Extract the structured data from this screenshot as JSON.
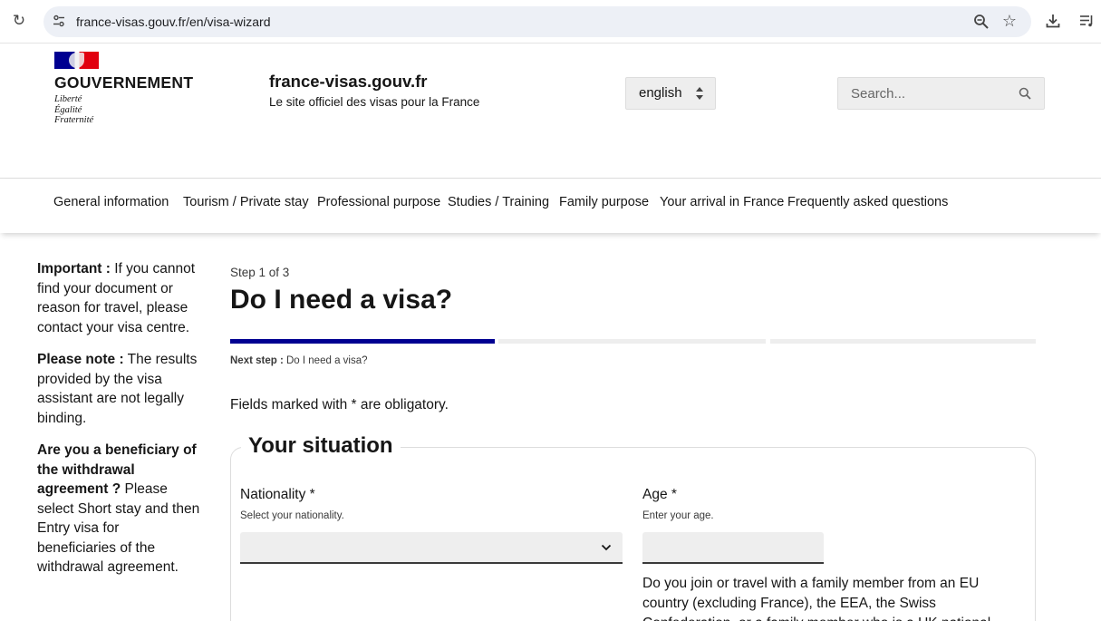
{
  "browser": {
    "url": "france-visas.gouv.fr/en/visa-wizard",
    "icons": [
      "reload-icon",
      "site-info-icon",
      "zoom-icon",
      "star-icon",
      "download-icon",
      "reading-list-icon"
    ]
  },
  "header": {
    "gov_name": "GOUVERNEMENT",
    "motto": [
      "Liberté",
      "Égalité",
      "Fraternité"
    ],
    "site_title": "france-visas.gouv.fr",
    "site_tagline": "Le site officiel des visas pour la France",
    "language": "english",
    "search_placeholder": "Search..."
  },
  "nav": {
    "items": [
      "General information",
      "Tourism / Private stay",
      "Professional purpose",
      "Studies / Training",
      "Family purpose",
      "Your arrival in France",
      "Frequently asked questions"
    ]
  },
  "sidebar": {
    "important_label": "Important :",
    "important_text": "If you cannot find your document or reason for travel, please contact your visa centre.",
    "note_label": "Please note :",
    "note_text": "The results provided by the visa assistant are not legally binding.",
    "beneficiary_label": "Are you a beneficiary of the withdrawal agreement ?",
    "beneficiary_text": "Please select Short stay and then Entry visa for beneficiaries of the withdrawal agreement."
  },
  "wizard": {
    "step_label": "Step 1 of 3",
    "title": "Do I need a visa?",
    "progress": {
      "current": 1,
      "total": 3
    },
    "next_step_label": "Next step :",
    "next_step_value": "Do I need a visa?",
    "obligatory_note": "Fields marked with * are obligatory.",
    "section_title": "Your situation",
    "nationality_label": "Nationality *",
    "nationality_hint": "Select your nationality.",
    "nationality_value": "",
    "age_label": "Age *",
    "age_hint": "Enter your age.",
    "age_value": "",
    "family_question": "Do you join or travel with a family member from an EU country (excluding France), the EEA, the Swiss Confederation, or a family member who is a UK national"
  },
  "colors": {
    "accent": "#000091",
    "text": "#161616",
    "field_bg": "#eeeeee",
    "flag_red": "#e1000f"
  }
}
